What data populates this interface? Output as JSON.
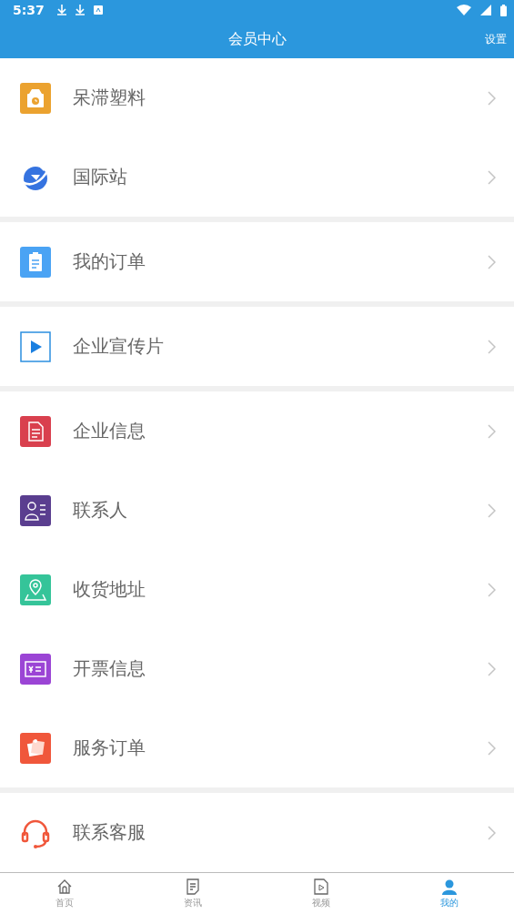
{
  "status_bar": {
    "time": "5:37"
  },
  "header": {
    "title": "会员中心",
    "action": "设置"
  },
  "sections": [
    {
      "items": [
        {
          "label": "呆滞塑料"
        },
        {
          "label": "国际站"
        }
      ]
    },
    {
      "items": [
        {
          "label": "我的订单"
        }
      ]
    },
    {
      "items": [
        {
          "label": "企业宣传片"
        }
      ]
    },
    {
      "items": [
        {
          "label": "企业信息"
        },
        {
          "label": "联系人"
        },
        {
          "label": "收货地址"
        },
        {
          "label": "开票信息"
        },
        {
          "label": "服务订单"
        }
      ]
    },
    {
      "items": [
        {
          "label": "联系客服"
        }
      ]
    }
  ],
  "bottom_nav": [
    {
      "label": "首页",
      "selected": false
    },
    {
      "label": "资讯",
      "selected": false
    },
    {
      "label": "视频",
      "selected": false
    },
    {
      "label": "我的",
      "selected": true
    }
  ]
}
